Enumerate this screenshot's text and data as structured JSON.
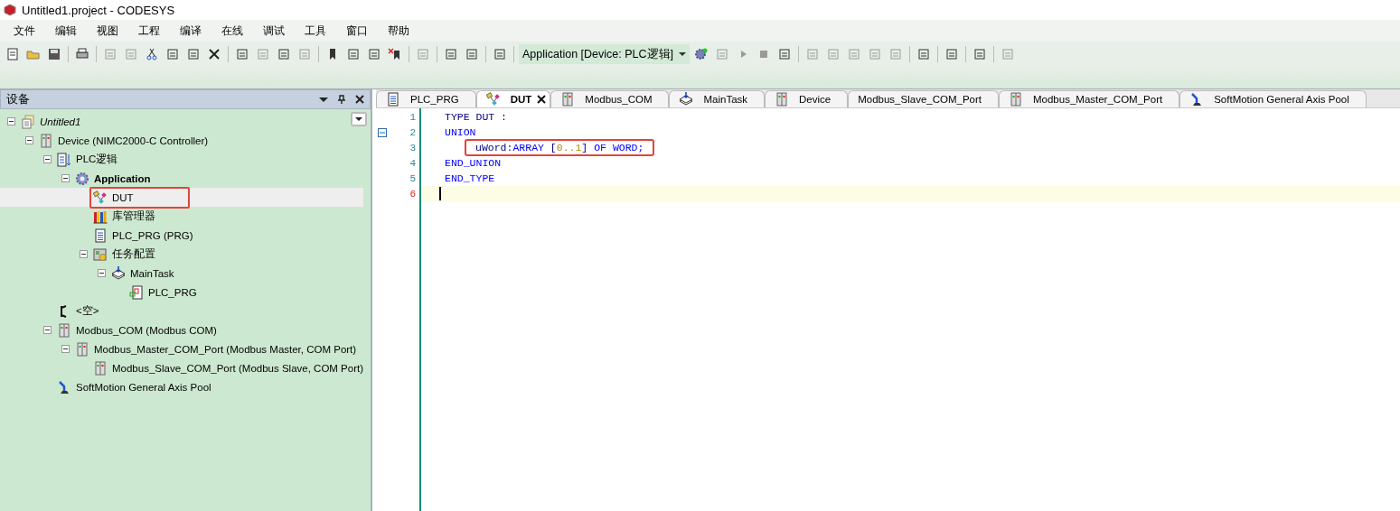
{
  "window": {
    "title": "Untitled1.project - CODESYS"
  },
  "menu": [
    "文件",
    "编辑",
    "视图",
    "工程",
    "编译",
    "在线",
    "调试",
    "工具",
    "窗口",
    "帮助"
  ],
  "toolbar": {
    "application_selector": "Application [Device: PLC逻辑]"
  },
  "devices_panel": {
    "title": "设备",
    "tree": [
      {
        "label": "Untitled1",
        "kind": "project",
        "expanded": true,
        "selected": false,
        "annotated": false,
        "children": [
          {
            "label": "Device (NIMC2000-C Controller)",
            "kind": "device",
            "expanded": true,
            "selected": false,
            "annotated": false,
            "children": [
              {
                "label": "PLC逻辑",
                "kind": "logic",
                "expanded": true,
                "selected": false,
                "annotated": false,
                "children": [
                  {
                    "label": "Application",
                    "kind": "application",
                    "expanded": true,
                    "selected": false,
                    "annotated": false,
                    "children": [
                      {
                        "label": "DUT",
                        "kind": "dut",
                        "selected": true,
                        "annotated": true
                      },
                      {
                        "label": "库管理器",
                        "kind": "library",
                        "selected": false,
                        "annotated": false
                      },
                      {
                        "label": "PLC_PRG (PRG)",
                        "kind": "pou",
                        "selected": false,
                        "annotated": false
                      },
                      {
                        "label": "任务配置",
                        "kind": "taskconfig",
                        "expanded": true,
                        "selected": false,
                        "annotated": false,
                        "children": [
                          {
                            "label": "MainTask",
                            "kind": "task",
                            "expanded": true,
                            "selected": false,
                            "annotated": false,
                            "children": [
                              {
                                "label": "PLC_PRG",
                                "kind": "call",
                                "selected": false,
                                "annotated": false
                              }
                            ]
                          }
                        ]
                      }
                    ]
                  }
                ]
              },
              {
                "label": "<空>",
                "kind": "empty",
                "selected": false,
                "annotated": false
              },
              {
                "label": "Modbus_COM (Modbus COM)",
                "kind": "device",
                "expanded": true,
                "selected": false,
                "annotated": false,
                "children": [
                  {
                    "label": "Modbus_Master_COM_Port (Modbus Master, COM Port)",
                    "kind": "device",
                    "expanded": true,
                    "selected": false,
                    "annotated": false,
                    "children": [
                      {
                        "label": "Modbus_Slave_COM_Port (Modbus Slave, COM Port)",
                        "kind": "device",
                        "selected": false,
                        "annotated": false
                      }
                    ]
                  }
                ]
              },
              {
                "label": "SoftMotion General Axis Pool",
                "kind": "axis",
                "selected": false,
                "annotated": false
              }
            ]
          }
        ]
      }
    ]
  },
  "editor": {
    "tabs": [
      {
        "label": "PLC_PRG",
        "kind": "pou",
        "selected": false
      },
      {
        "label": "DUT",
        "kind": "dut",
        "selected": true
      },
      {
        "label": "Modbus_COM",
        "kind": "device",
        "selected": false
      },
      {
        "label": "MainTask",
        "kind": "task",
        "selected": false
      },
      {
        "label": "Device",
        "kind": "device",
        "selected": false
      },
      {
        "label": "Modbus_Slave_COM_Port",
        "kind": "plain",
        "selected": false
      },
      {
        "label": "Modbus_Master_COM_Port",
        "kind": "device",
        "selected": false
      },
      {
        "label": "SoftMotion General Axis Pool",
        "kind": "axis",
        "selected": false
      }
    ],
    "lines": [
      {
        "number": "1",
        "kind": "statement",
        "current": false,
        "foldable": false,
        "annotated": false,
        "tokens": [
          {
            "text": "TYPE DUT :",
            "kind": "ident"
          }
        ]
      },
      {
        "number": "2",
        "kind": "statement",
        "current": false,
        "foldable": true,
        "annotated": false,
        "tokens": [
          {
            "text": "UNION",
            "kind": "keyword"
          }
        ]
      },
      {
        "number": "3",
        "kind": "member",
        "current": false,
        "foldable": false,
        "annotated": true,
        "tokens": [
          {
            "text": "uWord:",
            "kind": "ident"
          },
          {
            "text": "ARRAY",
            "kind": "keyword"
          },
          {
            "text": " [",
            "kind": "ident"
          },
          {
            "text": "0..1",
            "kind": "number"
          },
          {
            "text": "] ",
            "kind": "ident"
          },
          {
            "text": "OF WORD;",
            "kind": "keyword"
          }
        ]
      },
      {
        "number": "4",
        "kind": "statement",
        "current": false,
        "foldable": false,
        "annotated": false,
        "tokens": [
          {
            "text": "END_UNION",
            "kind": "keyword"
          }
        ]
      },
      {
        "number": "5",
        "kind": "statement",
        "current": false,
        "foldable": false,
        "annotated": false,
        "tokens": [
          {
            "text": "END_TYPE",
            "kind": "keyword"
          }
        ]
      },
      {
        "number": "6",
        "kind": "statement",
        "current": true,
        "foldable": false,
        "annotated": false
      }
    ]
  }
}
